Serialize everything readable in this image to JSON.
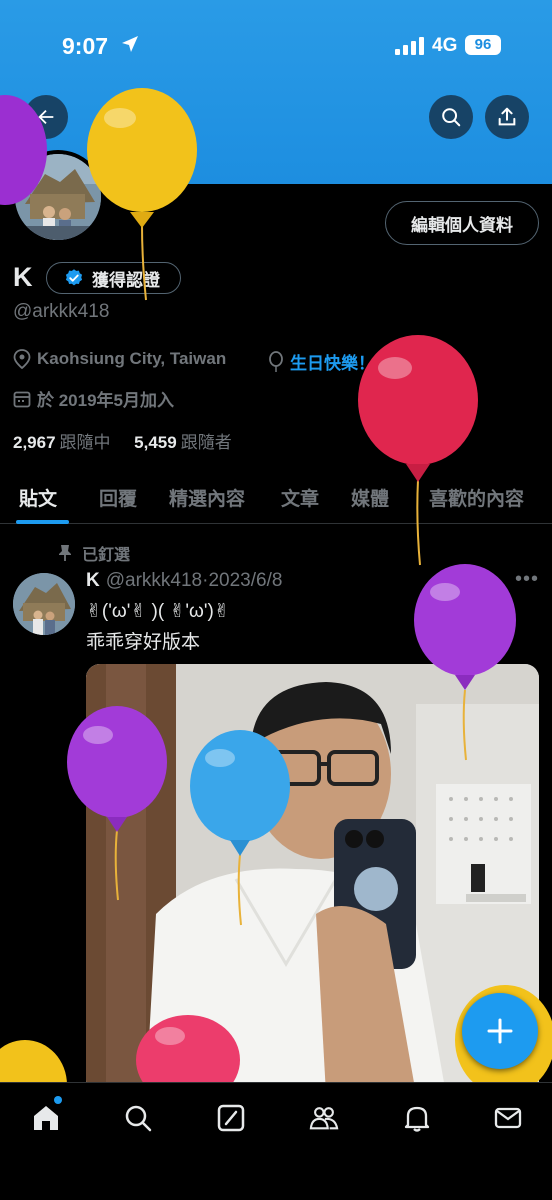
{
  "status_bar": {
    "time": "9:07",
    "network": "4G",
    "battery": "96"
  },
  "profile": {
    "name": "K",
    "verified_label": "獲得認證",
    "handle": "@arkkk418",
    "edit_label": "編輯個人資料",
    "location": "Kaohsiung City, Taiwan",
    "birthday_label": "生日快樂！",
    "joined": "於 2019年5月加入",
    "following_count": "2,967",
    "following_label": "跟隨中",
    "followers_count": "5,459",
    "followers_label": "跟隨者"
  },
  "tabs": [
    {
      "label": "貼文",
      "active": true
    },
    {
      "label": "回覆"
    },
    {
      "label": "精選內容"
    },
    {
      "label": "文章"
    },
    {
      "label": "媒體"
    },
    {
      "label": "喜歡的內容"
    }
  ],
  "tweet": {
    "pinned_label": "已釘選",
    "author_name": "K",
    "author_handle": "@arkkk418",
    "separator": "·",
    "date": "2023/6/8",
    "line1": "✌('ω'✌ )( ✌'ω')✌",
    "line2": "乖乖穿好版本"
  },
  "icons": {
    "back": "arrow-left-icon",
    "search": "search-icon",
    "share": "share-icon",
    "location": "location-pin-icon",
    "balloon": "balloon-icon",
    "calendar": "calendar-icon",
    "pin": "pin-icon",
    "compose": "plus-icon",
    "nav": [
      "home-icon",
      "search-icon",
      "grok-icon",
      "communities-icon",
      "notifications-icon",
      "messages-icon"
    ]
  },
  "colors": {
    "accent": "#1d9bf0",
    "banner": "#1d8ee0",
    "background": "#000000",
    "muted": "#71767b",
    "text": "#e7e9ea"
  }
}
